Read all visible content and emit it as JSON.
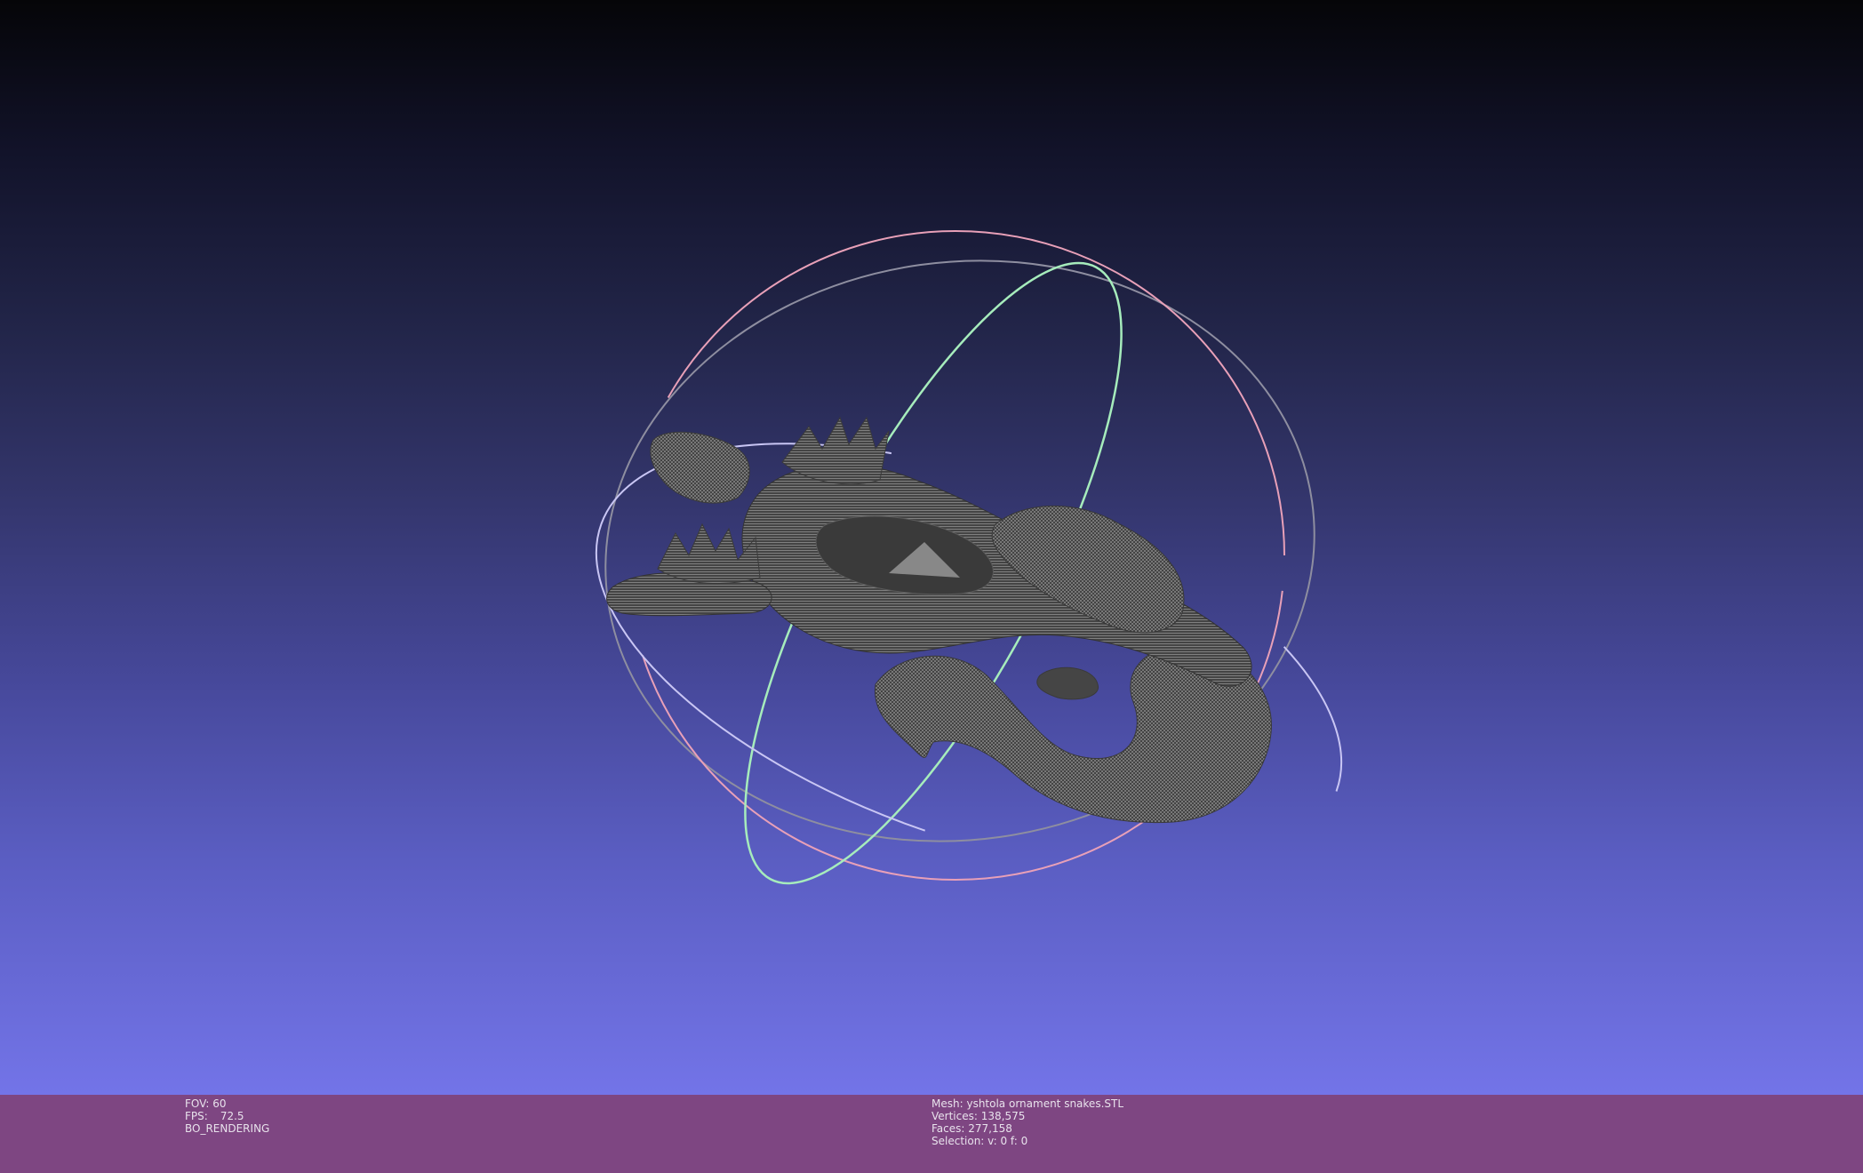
{
  "viewport": {
    "background_top": "#050508",
    "background_bottom": "#7374e8",
    "mesh_color": "#4a4a4a",
    "mesh_wire_color": "#9a9a9a",
    "trackball": {
      "x_ring_color": "#e89ab0",
      "y_ring_color": "#9ee8b0",
      "z_ring_color": "#c8c4f0",
      "neutral_ring_color": "#8a8a9a"
    }
  },
  "infobar": {
    "background": "#7e4682",
    "left": {
      "fov_label": "FOV:",
      "fov_value": "60",
      "fps_label": "FPS:",
      "fps_value": "72.5",
      "render_mode": "BO_RENDERING"
    },
    "center": {
      "mesh_label": "Mesh:",
      "mesh_name": "yshtola ornament snakes.STL",
      "vertices_label": "Vertices:",
      "vertices_value": "138,575",
      "faces_label": "Faces:",
      "faces_value": "277,158",
      "selection_label": "Selection:",
      "selection_value": "v: 0 f: 0"
    }
  }
}
